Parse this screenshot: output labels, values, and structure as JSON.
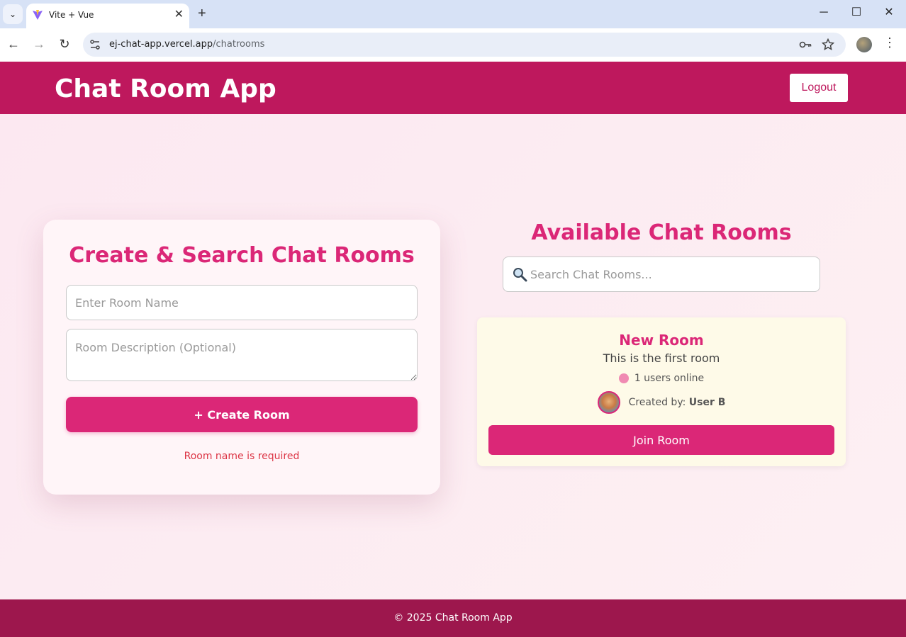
{
  "browser": {
    "tab_title": "Vite + Vue",
    "tab_close": "✕",
    "new_tab": "+",
    "url_host": "ej-chat-app.vercel.app",
    "url_path": "/chatrooms",
    "window_controls": {
      "minimize": "─",
      "maximize": "☐",
      "close": "✕"
    },
    "nav": {
      "back": "←",
      "forward": "→",
      "reload": "↻"
    },
    "icons": {
      "key": "key-icon",
      "star": "star-icon",
      "menu": "kebab-menu-icon"
    }
  },
  "header": {
    "title": "Chat Room App",
    "logout_label": "Logout",
    "background_color": "#be185d"
  },
  "create_panel": {
    "title": "Create & Search Chat Rooms",
    "room_name": {
      "value": "",
      "placeholder": "Enter Room Name"
    },
    "room_description": {
      "value": "",
      "placeholder": "Room Description (Optional)"
    },
    "create_button_label": "+ Create Room",
    "error_message": "Room name is required"
  },
  "rooms_panel": {
    "title": "Available Chat Rooms",
    "search": {
      "value": "",
      "placeholder": "Search Chat Rooms..."
    },
    "rooms": [
      {
        "name": "New Room",
        "description": "This is the first room",
        "online_text": "1 users online",
        "created_by_label": "Created by:",
        "created_by": "User B",
        "join_label": "Join Room"
      }
    ]
  },
  "footer": {
    "text": "© 2025 Chat Room App",
    "background_color": "#9d174d"
  },
  "colors": {
    "accent": "#db2777",
    "error": "#dc3545",
    "online_dot": "#f08ab2"
  }
}
